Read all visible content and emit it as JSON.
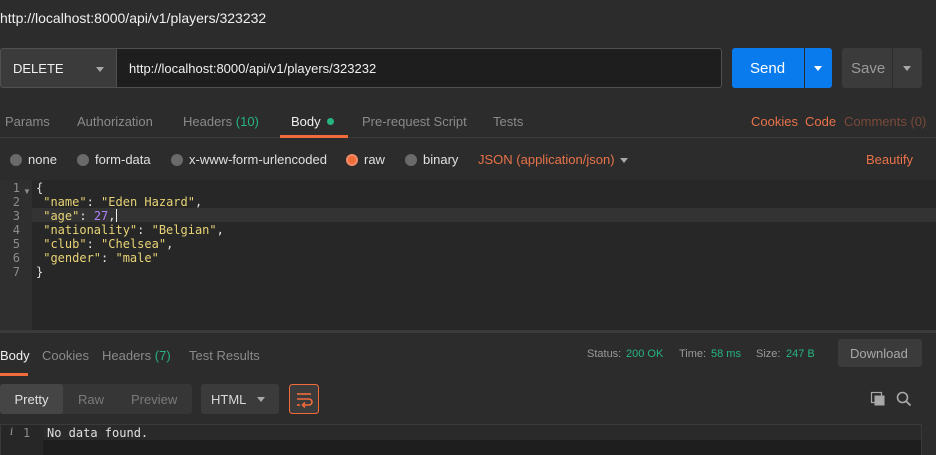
{
  "request": {
    "title": "http://localhost:8000/api/v1/players/323232",
    "method": "DELETE",
    "url": "http://localhost:8000/api/v1/players/323232",
    "send_label": "Send",
    "save_label": "Save"
  },
  "tabs": {
    "params": "Params",
    "authorization": "Authorization",
    "headers": "Headers",
    "headers_count": "(10)",
    "body": "Body",
    "prerequest": "Pre-request Script",
    "tests": "Tests",
    "cookies": "Cookies",
    "code": "Code",
    "comments": "Comments (0)"
  },
  "body_options": {
    "none": "none",
    "form_data": "form-data",
    "urlencoded": "x-www-form-urlencoded",
    "raw": "raw",
    "binary": "binary",
    "selected": "raw",
    "content_type": "JSON (application/json)",
    "beautify": "Beautify"
  },
  "editor": {
    "line_numbers": [
      "1",
      "2",
      "3",
      "4",
      "5",
      "6",
      "7"
    ],
    "open_brace": "{",
    "close_brace": "}",
    "fields": [
      {
        "key": "\"name\"",
        "value": "\"Eden Hazard\"",
        "trailing": ","
      },
      {
        "key": "\"age\"",
        "value": "27",
        "trailing": ","
      },
      {
        "key": "\"nationality\"",
        "value": "\"Belgian\"",
        "trailing": ","
      },
      {
        "key": "\"club\"",
        "value": "\"Chelsea\"",
        "trailing": ","
      },
      {
        "key": "\"gender\"",
        "value": "\"male\"",
        "trailing": ""
      }
    ]
  },
  "response": {
    "tabs": {
      "body": "Body",
      "cookies": "Cookies",
      "headers": "Headers",
      "headers_count": "(7)",
      "test_results": "Test Results"
    },
    "status_label": "Status:",
    "status_value": "200 OK",
    "time_label": "Time:",
    "time_value": "58 ms",
    "size_label": "Size:",
    "size_value": "247 B",
    "download_label": "Download",
    "view_modes": {
      "pretty": "Pretty",
      "raw": "Raw",
      "preview": "Preview"
    },
    "format": "HTML",
    "line_number": "1",
    "info_glyph": "i",
    "body_text": "No data found."
  },
  "colors": {
    "accent": "#f26b3a",
    "send": "#097bed",
    "success": "#26b47f"
  }
}
